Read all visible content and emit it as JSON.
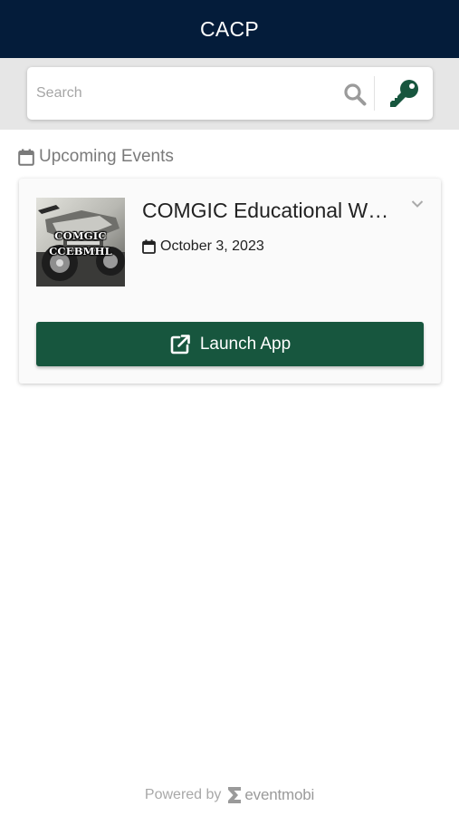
{
  "header": {
    "title": "CACP"
  },
  "search": {
    "placeholder": "Search",
    "value": "",
    "icon": "search-icon",
    "login_icon": "key-icon"
  },
  "section": {
    "heading": "Upcoming Events",
    "icon": "calendar-icon"
  },
  "events": [
    {
      "title": "COMGIC Educational W…",
      "date": "October 3, 2023",
      "thumbnail_text": [
        "COMGIC",
        "CCEBMHL"
      ],
      "expand_icon": "chevron-down-icon",
      "launch_label": "Launch App",
      "launch_icon": "external-link-icon"
    }
  ],
  "footer": {
    "powered_by": "Powered by",
    "brand": "eventmobi"
  },
  "colors": {
    "header_bg": "#041c3a",
    "accent_green": "#17563e",
    "search_band_bg": "#e6e6e6",
    "card_bg": "#fafafa",
    "muted_text": "#7a7a7a"
  }
}
